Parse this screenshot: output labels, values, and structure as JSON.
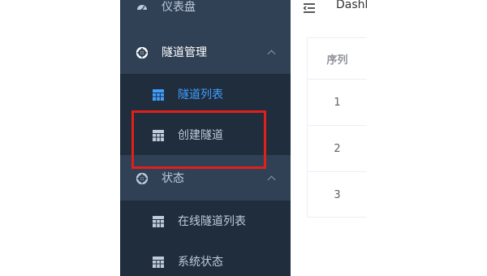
{
  "sidebar": {
    "items": [
      {
        "label": "仪表盘",
        "icon": "dashboard-icon"
      },
      {
        "label": "隧道管理",
        "icon": "lifebuoy-icon",
        "expanded": true,
        "children": [
          {
            "label": "隧道列表",
            "icon": "table-icon",
            "active": true
          },
          {
            "label": "创建隧道",
            "icon": "table-icon",
            "active": false
          }
        ]
      },
      {
        "label": "状态",
        "icon": "lifebuoy-icon",
        "expanded": true,
        "children": [
          {
            "label": "在线隧道列表",
            "icon": "table-icon"
          },
          {
            "label": "系统状态",
            "icon": "table-icon"
          }
        ]
      }
    ]
  },
  "navbar": {
    "breadcrumb": "Dashboard",
    "icon": "hamburger-icon"
  },
  "table": {
    "header": "序列",
    "rows": [
      "1",
      "2",
      "3"
    ]
  },
  "colors": {
    "sidebar_bg": "#304156",
    "submenu_bg": "#1f2d3d",
    "active_text": "#409eff",
    "menu_text": "#bfcbd9",
    "highlight_border": "#e0201a"
  }
}
